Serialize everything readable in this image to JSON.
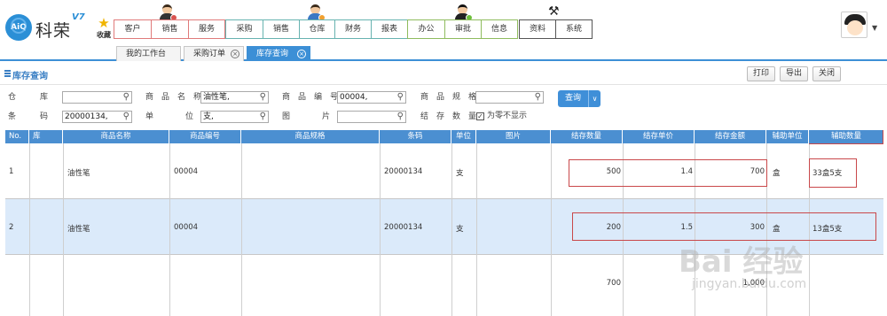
{
  "app": {
    "logo_text": "AiQ",
    "brand": "科荣",
    "version": "V7"
  },
  "favorites": {
    "label": "收藏"
  },
  "nav_groups": [
    {
      "items": [
        "客户",
        "销售",
        "服务"
      ]
    },
    {
      "items": [
        "采购",
        "销售",
        "仓库",
        "财务",
        "报表"
      ]
    },
    {
      "items": [
        "办公",
        "审批",
        "信息"
      ]
    },
    {
      "items": [
        "资料",
        "系统"
      ]
    }
  ],
  "tabs": [
    {
      "label": "我的工作台"
    },
    {
      "label": "采购订单"
    },
    {
      "label": "库存查询"
    }
  ],
  "tab_close": "⊗",
  "page": {
    "title": "库存查询",
    "buttons": {
      "print": "打印",
      "export": "导出",
      "close": "关闭"
    }
  },
  "filters": {
    "warehouse": {
      "label": "仓　　　库",
      "value": ""
    },
    "product_name": {
      "label": "商　品　名　称",
      "value": "油性笔,"
    },
    "product_code": {
      "label": "商　品　编　号",
      "value": "00004,"
    },
    "product_spec": {
      "label": "商　品　规　格",
      "value": ""
    },
    "barcode": {
      "label": "条　　　码",
      "value": "20000134,"
    },
    "unit": {
      "label": "单　　　　位",
      "value": "支,"
    },
    "image": {
      "label": "图　　　　片",
      "value": ""
    },
    "stock_qty": {
      "label": "结　存　数　量",
      "zero_hidden_label": "为零不显示",
      "checked": "✓"
    },
    "query_label": "查询"
  },
  "table": {
    "headers": [
      "No.",
      "库",
      "商品名称",
      "商品编号",
      "商品规格",
      "条码",
      "单位",
      "图片",
      "结存数量",
      "结存单价",
      "结存金额",
      "辅助单位",
      "辅助数量"
    ],
    "rows": [
      {
        "no": "1",
        "warehouse": "",
        "name": "油性笔",
        "code": "00004",
        "spec": "",
        "barcode": "20000134",
        "unit": "支",
        "image": "",
        "qty": "500",
        "price": "1.4",
        "amount": "700",
        "aux_unit": "盒",
        "aux_qty": "33盒5支"
      },
      {
        "no": "2",
        "warehouse": "",
        "name": "油性笔",
        "code": "00004",
        "spec": "",
        "barcode": "20000134",
        "unit": "支",
        "image": "",
        "qty": "200",
        "price": "1.5",
        "amount": "300",
        "aux_unit": "盒",
        "aux_qty": "13盒5支"
      }
    ],
    "totals": {
      "qty": "700",
      "amount": "1,000"
    }
  },
  "watermark": {
    "main": "Bai 经验",
    "sub": "jingyan.baidu.com"
  },
  "colors": {
    "accent": "#3c8fd6",
    "header_blue": "#4b8fd1",
    "highlight_box": "#c9484a",
    "selected_row": "#dbeafa"
  }
}
